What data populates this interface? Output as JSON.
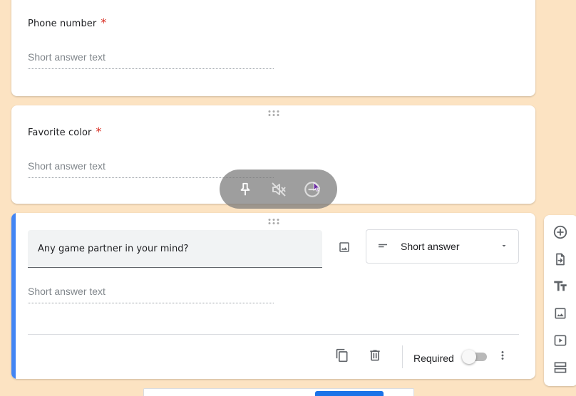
{
  "questions": [
    {
      "title": "Phone number",
      "required_mark": "*",
      "answer_placeholder": "Short answer text"
    },
    {
      "title": "Favorite color",
      "required_mark": "*",
      "answer_placeholder": "Short answer text"
    }
  ],
  "active_question": {
    "title": "Any game partner in your mind?",
    "answer_placeholder": "Short answer text",
    "type_select": {
      "selected": "Short answer",
      "icon": "short-text-icon"
    },
    "footer": {
      "required_label": "Required",
      "required_on": false
    }
  },
  "floating_controls": {
    "icons": [
      "pin-icon",
      "mute-icon",
      "remove-circle-icon"
    ]
  },
  "side_toolbar": {
    "icons": [
      "add-question-icon",
      "import-questions-icon",
      "add-title-icon",
      "add-image-icon",
      "add-video-icon",
      "add-section-icon"
    ]
  },
  "colors": {
    "background": "#fce3c2",
    "accent": "#4285f4",
    "required": "#d93025",
    "primary_button": "#1a73e8"
  }
}
